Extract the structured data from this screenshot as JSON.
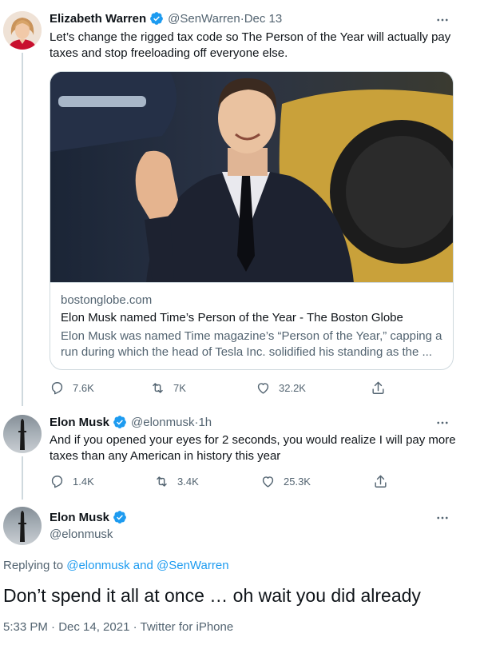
{
  "tweet1": {
    "name": "Elizabeth Warren",
    "handle": "@SenWarren",
    "separator": " · ",
    "date": "Dec 13",
    "text": "Let’s change the rigged tax code so The Person of the Year will actually pay taxes and stop freeloading off everyone else.",
    "card": {
      "domain": "bostonglobe.com",
      "title": "Elon Musk named Time’s Person of the Year - The Boston Globe",
      "description": "Elon Musk was named Time magazine’s “Person of the Year,” capping a run during which the head of Tesla Inc. solidified his standing as the ..."
    },
    "actions": {
      "replies": "7.6K",
      "retweets": "7K",
      "likes": "32.2K"
    }
  },
  "tweet2": {
    "name": "Elon Musk",
    "handle": "@elonmusk",
    "separator": " · ",
    "date": "1h",
    "text": "And if you opened your eyes for 2 seconds, you would realize I will pay more taxes than any American in history this year",
    "actions": {
      "replies": "1.4K",
      "retweets": "3.4K",
      "likes": "25.3K"
    }
  },
  "main_tweet": {
    "name": "Elon Musk",
    "handle": "@elonmusk",
    "replying_prefix": "Replying to ",
    "replying_mentions": "@elonmusk and @SenWarren",
    "text": "Don’t spend it all at once … oh wait you did already",
    "meta": "5:33 PM · Dec 14, 2021 · Twitter for iPhone"
  },
  "colors": {
    "accent": "#1d9bf0",
    "secondary_text": "#536471",
    "border": "#cfd9de"
  },
  "icons": [
    "verified-badge-icon",
    "more-icon",
    "reply-icon",
    "retweet-icon",
    "like-icon",
    "share-icon"
  ]
}
